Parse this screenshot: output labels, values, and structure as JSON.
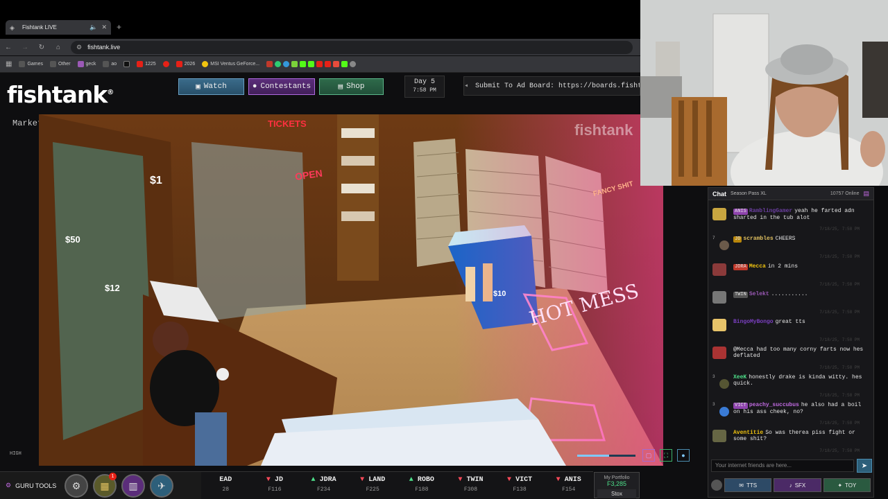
{
  "browser": {
    "tab_title": "Fishtank LIVE",
    "new_tab": "+",
    "url": "fishtank.live",
    "bookmarks": [
      {
        "label": "Games",
        "color": "#555"
      },
      {
        "label": "Other",
        "color": "#555"
      },
      {
        "label": "geck",
        "color": "#9b59b6"
      },
      {
        "label": "ao",
        "color": "#555"
      },
      {
        "label": "",
        "color": "#222"
      },
      {
        "label": "1225",
        "color": "#e62117"
      },
      {
        "label": "",
        "color": "#e62117"
      },
      {
        "label": "2026",
        "color": "#e62117"
      },
      {
        "label": "MSI Ventus GeForce...",
        "color": "#f1c40f"
      }
    ]
  },
  "site": {
    "logo": "fishtank",
    "logo_mark": "®",
    "nav": {
      "watch": "Watch",
      "contestants": "Contestants",
      "shop": "Shop"
    },
    "day": "Day 5",
    "time": "7:58 PM",
    "adboard": "Submit To Ad Board: https://boards.fishtank.live"
  },
  "video": {
    "camera_label": "Market Alternate",
    "watermark": "fishtank",
    "quality": "HIGH",
    "volume": 0.55,
    "signs": {
      "tickets": "TICKETS",
      "open": "OPEN",
      "fancy": "FANCY SHIT",
      "neon": "HOT MESS",
      "price1": "$1",
      "price50": "$50",
      "price12": "$12",
      "price10": "$10"
    }
  },
  "tools": {
    "label": "GURU TOOLS",
    "badge": "1"
  },
  "ticker": [
    {
      "name": "EAD",
      "price": "28",
      "dir": ""
    },
    {
      "name": "JD",
      "price": "F116",
      "dir": "dn"
    },
    {
      "name": "JDRA",
      "price": "F234",
      "dir": "up"
    },
    {
      "name": "LAND",
      "price": "F225",
      "dir": "dn"
    },
    {
      "name": "ROBO",
      "price": "F188",
      "dir": "up"
    },
    {
      "name": "TWIN",
      "price": "F308",
      "dir": "dn"
    },
    {
      "name": "VICT",
      "price": "F138",
      "dir": "dn"
    },
    {
      "name": "ANIS",
      "price": "F154",
      "dir": "dn"
    }
  ],
  "portfolio": {
    "label": "My Portfolio",
    "value": "F3,285",
    "button": "Stox"
  },
  "chat": {
    "title": "Chat",
    "season": "Season Pass XL",
    "online": "10757 Online",
    "placeholder": "Your internet friends are here...",
    "send": "➤",
    "buttons": {
      "tts": "TTS",
      "sfx": "SFX",
      "toy": "TOY"
    },
    "messages": [
      {
        "level": "",
        "tag": "ANIS",
        "tag_color": "#8e44ad",
        "user": "RamblingGamer",
        "user_color": "#6b3fa0",
        "text": "yeah he farted adn sharted in the tub alot",
        "time": "7/18/25, 7:58 PM",
        "av": "#c9a640"
      },
      {
        "level": "7",
        "tag": "JD",
        "tag_color": "#b8860b",
        "user": "scrambles",
        "user_color": "#e0c060",
        "text": "CHEERS",
        "time": "7/18/25, 7:58 PM",
        "av": "#6b5a4a"
      },
      {
        "level": "",
        "tag": "JDRA",
        "tag_color": "#c0392b",
        "user": "Mecca",
        "user_color": "#f1c40f",
        "text": "in 2 mins",
        "time": "7/18/25, 7:58 PM",
        "av": "#8b3a3a"
      },
      {
        "level": "",
        "tag": "TWIN",
        "tag_color": "#555",
        "user": "Selekt",
        "user_color": "#9b59b6",
        "text": "...........",
        "time": "7/18/25, 7:58 PM",
        "av": "#777"
      },
      {
        "level": "",
        "tag": "",
        "tag_color": "#333",
        "user": "BingoMyBongo",
        "user_color": "#7a3fc0",
        "text": "great tts",
        "time": "7/18/25, 7:58 PM",
        "av": "#e8c46a"
      },
      {
        "level": "",
        "tag": "",
        "tag_color": "#333",
        "user": "",
        "user_color": "#c0392b",
        "text": "@Mecca had too many corny farts now hes deflated",
        "time": "7/18/25, 7:58 PM",
        "av": "#a33"
      },
      {
        "level": "3",
        "tag": "",
        "tag_color": "#333",
        "user": "XeeK",
        "user_color": "#4ee08a",
        "text": "honestly drake is kinda witty. hes quick.",
        "time": "7/18/25, 7:58 PM",
        "av": "#553"
      },
      {
        "level": "3",
        "tag": "VICT",
        "tag_color": "#8e44ad",
        "user": "peachy_succubus",
        "user_color": "#c06ae0",
        "text": "he also had a boil on his ass cheek, no?",
        "time": "7/18/25, 7:58 PM",
        "av": "#3a7bd5"
      },
      {
        "level": "",
        "tag": "",
        "tag_color": "#333",
        "user": "Aventitie",
        "user_color": "#f1c40f",
        "text": "So was therea piss fight or some shit?",
        "time": "7/18/25, 7:58 PM",
        "av": "#664"
      }
    ]
  }
}
